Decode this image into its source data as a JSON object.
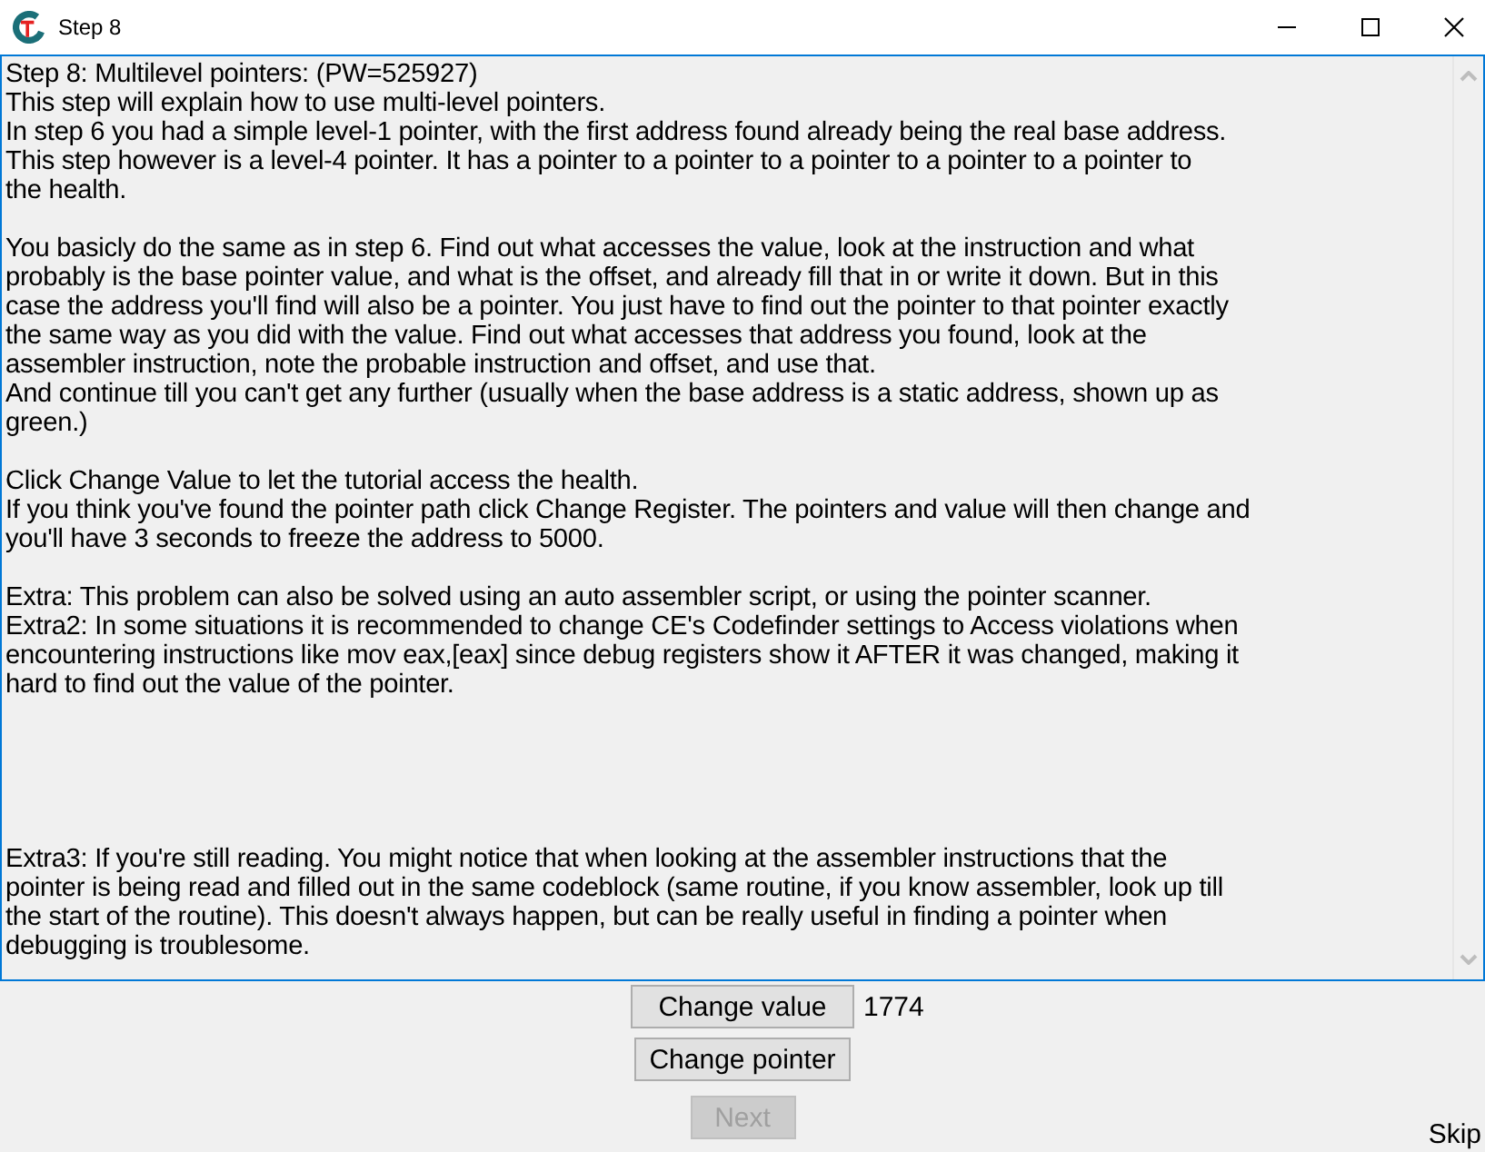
{
  "window": {
    "title": "Step 8"
  },
  "memo": {
    "paragraphs": [
      {
        "kind": "first",
        "lines": [
          "Step 8: Multilevel pointers: (PW=525927)",
          "This step will explain how to use multi-level pointers.",
          "In step 6 you had a simple level-1 pointer, with the first address found already being the real base address.",
          "This step however is a level-4 pointer. It has a pointer to a pointer to a pointer to a pointer to a pointer to",
          "the health."
        ]
      },
      {
        "kind": "gap",
        "lines": [
          "You basicly do the same as in step 6. Find out what accesses the value, look at the instruction and what",
          "probably is the base pointer value, and what is the offset, and already fill that in or write it down. But in this",
          "case the address you'll find will also be a pointer. You just have to find out the pointer to that pointer exactly",
          "the same way as you did with the value. Find out what accesses that address you found, look at the",
          "assembler instruction, note the probable instruction and offset, and use that.",
          "And continue till you can't get any further (usually when the base address is a static address, shown up as",
          "green.)"
        ]
      },
      {
        "kind": "gap",
        "lines": [
          "Click Change Value to let the tutorial access the health.",
          "If you think you've found the pointer path click Change Register. The pointers and value will then change and",
          "you'll have 3 seconds to freeze the address to 5000."
        ]
      },
      {
        "kind": "gap",
        "lines": [
          "Extra: This problem can also be solved using an auto assembler script, or using the pointer scanner.",
          "Extra2: In some situations it is recommended to change CE's Codefinder settings to Access violations when",
          "encountering instructions like mov eax,[eax] since debug registers show it AFTER it was changed, making it",
          "hard to find out the value of the pointer."
        ]
      },
      {
        "kind": "wide_gap",
        "lines": [
          "Extra3: If you're still reading. You might notice that when looking at the assembler instructions that the",
          "pointer is being read and filled out in the same codeblock (same routine, if you know assembler, look up till",
          "the start of the routine). This doesn't always happen, but can be really useful in finding a pointer when",
          "debugging is troublesome."
        ]
      }
    ]
  },
  "change_value": {
    "label": "Change value",
    "disabled": false
  },
  "value": "1774",
  "change_pointer": {
    "label": "Change pointer",
    "disabled": false
  },
  "next": {
    "label": "Next",
    "disabled": true
  },
  "skip": "Skip"
}
